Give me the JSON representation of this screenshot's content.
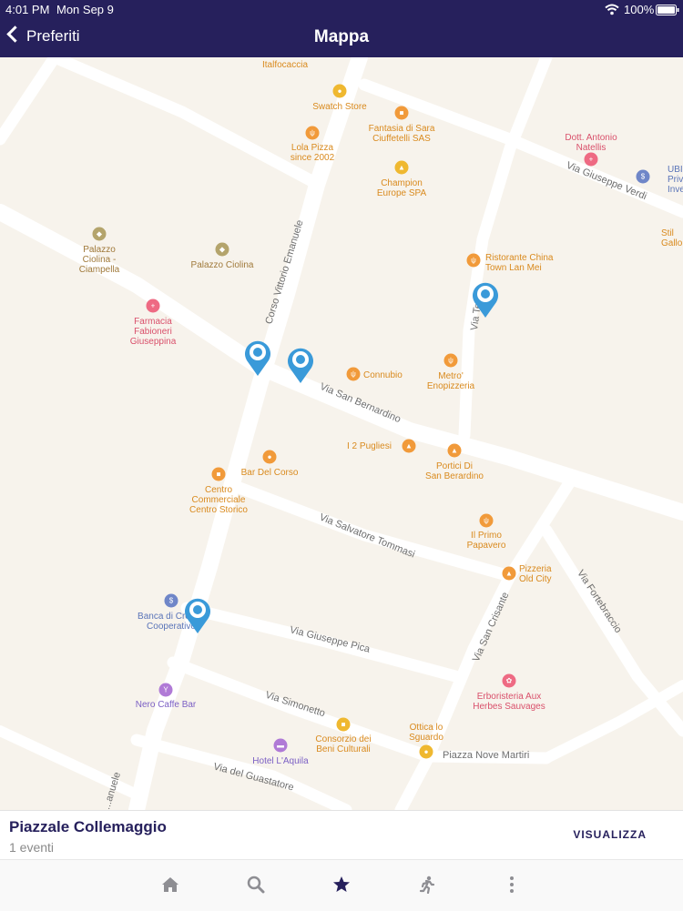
{
  "status_bar": {
    "time": "4:01 PM",
    "date": "Mon Sep 9",
    "battery": "100%"
  },
  "header": {
    "back_label": "Preferiti",
    "title": "Mappa"
  },
  "map": {
    "streets": {
      "corso_vittorio": "Corso Vittorio Emanuele",
      "san_bernardino": "Via San Bernardino",
      "salvatore_tommasi": "Via Salvatore Tommasi",
      "giuseppe_pica": "Via Giuseppe Pica",
      "simonetto": "Via Simonetto",
      "guastatore": "Via del Guastatore",
      "san_crisante": "Via San Crisante",
      "fortebraccio": "Via Fortebraccio",
      "giuseppe_verdi": "Via Giuseppe Verdi",
      "temera": "Via Tem...",
      "piazza_nove_martiri": "Piazza Nove Martiri",
      "emanuele_bottom": "...anuele"
    },
    "places": {
      "italfocaccia": "Italfocaccia",
      "swatch": "Swatch Store",
      "fantasia": "Fantasia di Sara\nCiuffetelli SAS",
      "lola": "Lola Pizza\nsince 2002",
      "natellis": "Dott. Antonio\nNatellis",
      "ubi": "UBI Ba\nPrivat\nInvest",
      "champion": "Champion\nEurope SPA",
      "stile": "Stil\nGallo",
      "palazzo_ciolina_ciampella": "Palazzo\nCiolina -\nCiampella",
      "palazzo_ciolina": "Palazzo Ciolina",
      "ristorante_china": "Ristorante China\nTown Lan Mei",
      "farmacia": "Farmacia\nFabioneri\nGiuseppina",
      "connubio": "Connubio",
      "metro": "Metro'\nEnopizzeria",
      "pugliesi": "I 2 Pugliesi",
      "portici": "Portici Di\nSan Berardino",
      "bar_corso": "Bar Del Corso",
      "centro_commerciale": "Centro\nCommerciale\nCentro Storico",
      "primo_papavero": "Il Primo\nPapavero",
      "pizzeria_old_city": "Pizzeria\nOld City",
      "banca": "Banca di Credito\nCooperativo",
      "erboristeria": "Erboristeria Aux\nHerbes Sauvages",
      "nero_caffe": "Nero Caffe Bar",
      "ottica": "Ottica lo\nSguardo",
      "consorzio": "Consorzio dei\nBeni Culturali",
      "hotel_aquila": "Hotel L'Aquila"
    }
  },
  "selection": {
    "name": "Piazzale Collemaggio",
    "events": "1 eventi",
    "action": "VISUALIZZA"
  },
  "tabs": [
    {
      "icon": "home-icon"
    },
    {
      "icon": "search-icon"
    },
    {
      "icon": "star-icon"
    },
    {
      "icon": "running-icon"
    },
    {
      "icon": "more-icon"
    }
  ],
  "colors": {
    "primary": "#26205c",
    "pin": "#3a9ad9",
    "map_bg": "#f7f3ec",
    "road": "#ffffff"
  }
}
